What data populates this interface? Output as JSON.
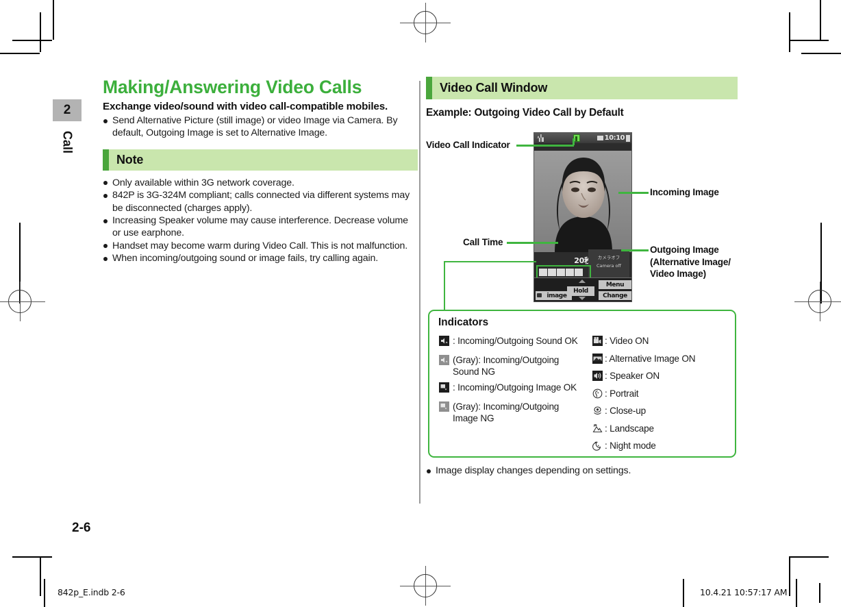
{
  "chapter": {
    "number": "2",
    "label": "Call"
  },
  "page_number": "2-6",
  "left": {
    "title": "Making/Answering Video Calls",
    "lead": "Exchange video/sound with video call-compatible mobiles.",
    "intro_bullets": [
      "Send Alternative Picture (still image) or video Image via Camera. By default, Outgoing Image is set to Alternative Image."
    ],
    "note_heading": "Note",
    "note_bullets": [
      "Only available within 3G network coverage.",
      "842P is 3G-324M compliant; calls connected via different systems may be disconnected (charges apply).",
      "Increasing Speaker volume may cause interference. Decrease volume or use earphone.",
      "Handset may become warm during Video Call. This is not malfunction.",
      "When incoming/outgoing sound or image fails, try calling again."
    ]
  },
  "right": {
    "section_heading": "Video Call Window",
    "subheading": "Example: Outgoing Video Call by Default",
    "callouts": {
      "video_call_indicator": "Video Call Indicator",
      "call_time": "Call Time",
      "incoming_image": "Incoming Image",
      "outgoing_image_line1": "Outgoing Image",
      "outgoing_image_line2": "(Alternative Image/",
      "outgoing_image_line3": "Video Image)"
    },
    "phone_screen": {
      "clock": "10:10",
      "call_time": "20秒",
      "camera_off_jp": "カメラオフ",
      "camera_off_en": "Camera off",
      "softkeys": {
        "image": "image",
        "hold": "Hold",
        "menu": "Menu",
        "change": "Change"
      }
    },
    "indicators": {
      "heading": "Indicators",
      "left_column": [
        {
          "icon": "sound-ok-icon",
          "style": "dark",
          "text": ": Incoming/Outgoing Sound OK"
        },
        {
          "icon": "sound-ng-icon",
          "style": "gray",
          "text": "(Gray): Incoming/Outgoing Sound NG"
        },
        {
          "icon": "image-ok-icon",
          "style": "dark",
          "text": ": Incoming/Outgoing Image OK"
        },
        {
          "icon": "image-ng-icon",
          "style": "gray",
          "text": "(Gray): Incoming/Outgoing Image NG"
        }
      ],
      "right_column": [
        {
          "icon": "video-on-icon",
          "style": "dark",
          "text": ": Video ON"
        },
        {
          "icon": "alternative-image-on-icon",
          "style": "dark",
          "text": ": Alternative Image ON"
        },
        {
          "icon": "speaker-on-icon",
          "style": "dark",
          "text": ": Speaker ON"
        },
        {
          "icon": "portrait-icon",
          "style": "blank",
          "text": ": Portrait"
        },
        {
          "icon": "close-up-icon",
          "style": "blank",
          "text": ": Close-up"
        },
        {
          "icon": "landscape-icon",
          "style": "blank",
          "text": ": Landscape"
        },
        {
          "icon": "night-mode-icon",
          "style": "blank",
          "text": ": Night mode"
        }
      ]
    },
    "after_note_bullets": [
      "Image display changes depending on settings."
    ]
  },
  "print_bar": {
    "file_info": "842p_E.indb   2-6",
    "timestamp": "10.4.21   10:57:17 AM"
  },
  "colors": {
    "title_green": "#3caf3c",
    "band_green": "#c9e6ad",
    "accent_green": "#4aa63c",
    "leader_green": "#3fb53f"
  }
}
